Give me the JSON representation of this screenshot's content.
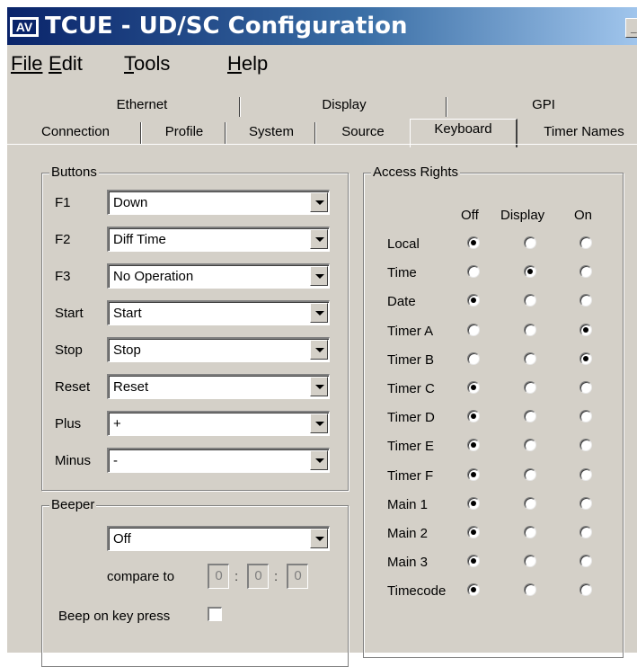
{
  "window": {
    "title": "TCUE - UD/SC Configuration",
    "icon_text": "AV",
    "minimize_glyph": "_"
  },
  "menu": [
    "File",
    "Edit",
    "Tools",
    "Help"
  ],
  "tabs": {
    "row1": [
      "Ethernet",
      "Display",
      "GPI"
    ],
    "row2": [
      "Connection",
      "Profile",
      "System",
      "Source",
      "Keyboard",
      "Timer Names"
    ],
    "active": "Keyboard"
  },
  "buttons_group": {
    "title": "Buttons",
    "rows": [
      {
        "label": "F1",
        "value": "Down"
      },
      {
        "label": "F2",
        "value": "Diff Time"
      },
      {
        "label": "F3",
        "value": "No Operation"
      },
      {
        "label": "Start",
        "value": "Start"
      },
      {
        "label": "Stop",
        "value": "Stop"
      },
      {
        "label": "Reset",
        "value": "Reset"
      },
      {
        "label": "Plus",
        "value": "+"
      },
      {
        "label": "Minus",
        "value": "-"
      }
    ]
  },
  "beeper_group": {
    "title": "Beeper",
    "mode_value": "Off",
    "compare_label": "compare to",
    "compare_values": [
      "0",
      "0",
      "0"
    ],
    "separator": ":",
    "beep_on_key_label": "Beep on key press",
    "beep_on_key_checked": false
  },
  "access_group": {
    "title": "Access Rights",
    "columns": [
      "Off",
      "Display",
      "On"
    ],
    "rows": [
      {
        "label": "Local",
        "selected": "Off"
      },
      {
        "label": "Time",
        "selected": "Display"
      },
      {
        "label": "Date",
        "selected": "Off"
      },
      {
        "label": "Timer A",
        "selected": "On"
      },
      {
        "label": "Timer B",
        "selected": "On"
      },
      {
        "label": "Timer C",
        "selected": "Off"
      },
      {
        "label": "Timer D",
        "selected": "Off"
      },
      {
        "label": "Timer E",
        "selected": "Off"
      },
      {
        "label": "Timer F",
        "selected": "Off"
      },
      {
        "label": "Main 1",
        "selected": "Off"
      },
      {
        "label": "Main 2",
        "selected": "Off"
      },
      {
        "label": "Main 3",
        "selected": "Off"
      },
      {
        "label": "Timecode",
        "selected": "Off"
      }
    ]
  },
  "colors": {
    "title_gradient_start": "#0a246a",
    "title_gradient_end": "#a6caf0",
    "face": "#d4d0c8"
  }
}
